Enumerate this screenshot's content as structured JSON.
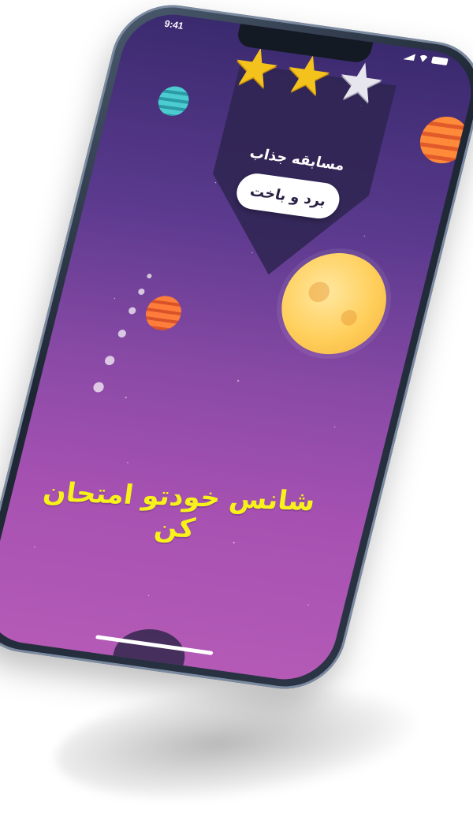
{
  "status_bar": {
    "time": "9:41"
  },
  "game": {
    "stars": [
      {
        "state": "filled"
      },
      {
        "state": "filled"
      },
      {
        "state": "empty"
      }
    ],
    "subtitle": "مسابقه جذاب",
    "action_button_label": "برد و باخت",
    "headline": "شانس خودتو امتحان کن"
  },
  "colors": {
    "headline": "#f7f21a",
    "star_filled": "#f4c21c",
    "star_empty": "#e7e6ee",
    "button_bg": "#ffffff"
  }
}
